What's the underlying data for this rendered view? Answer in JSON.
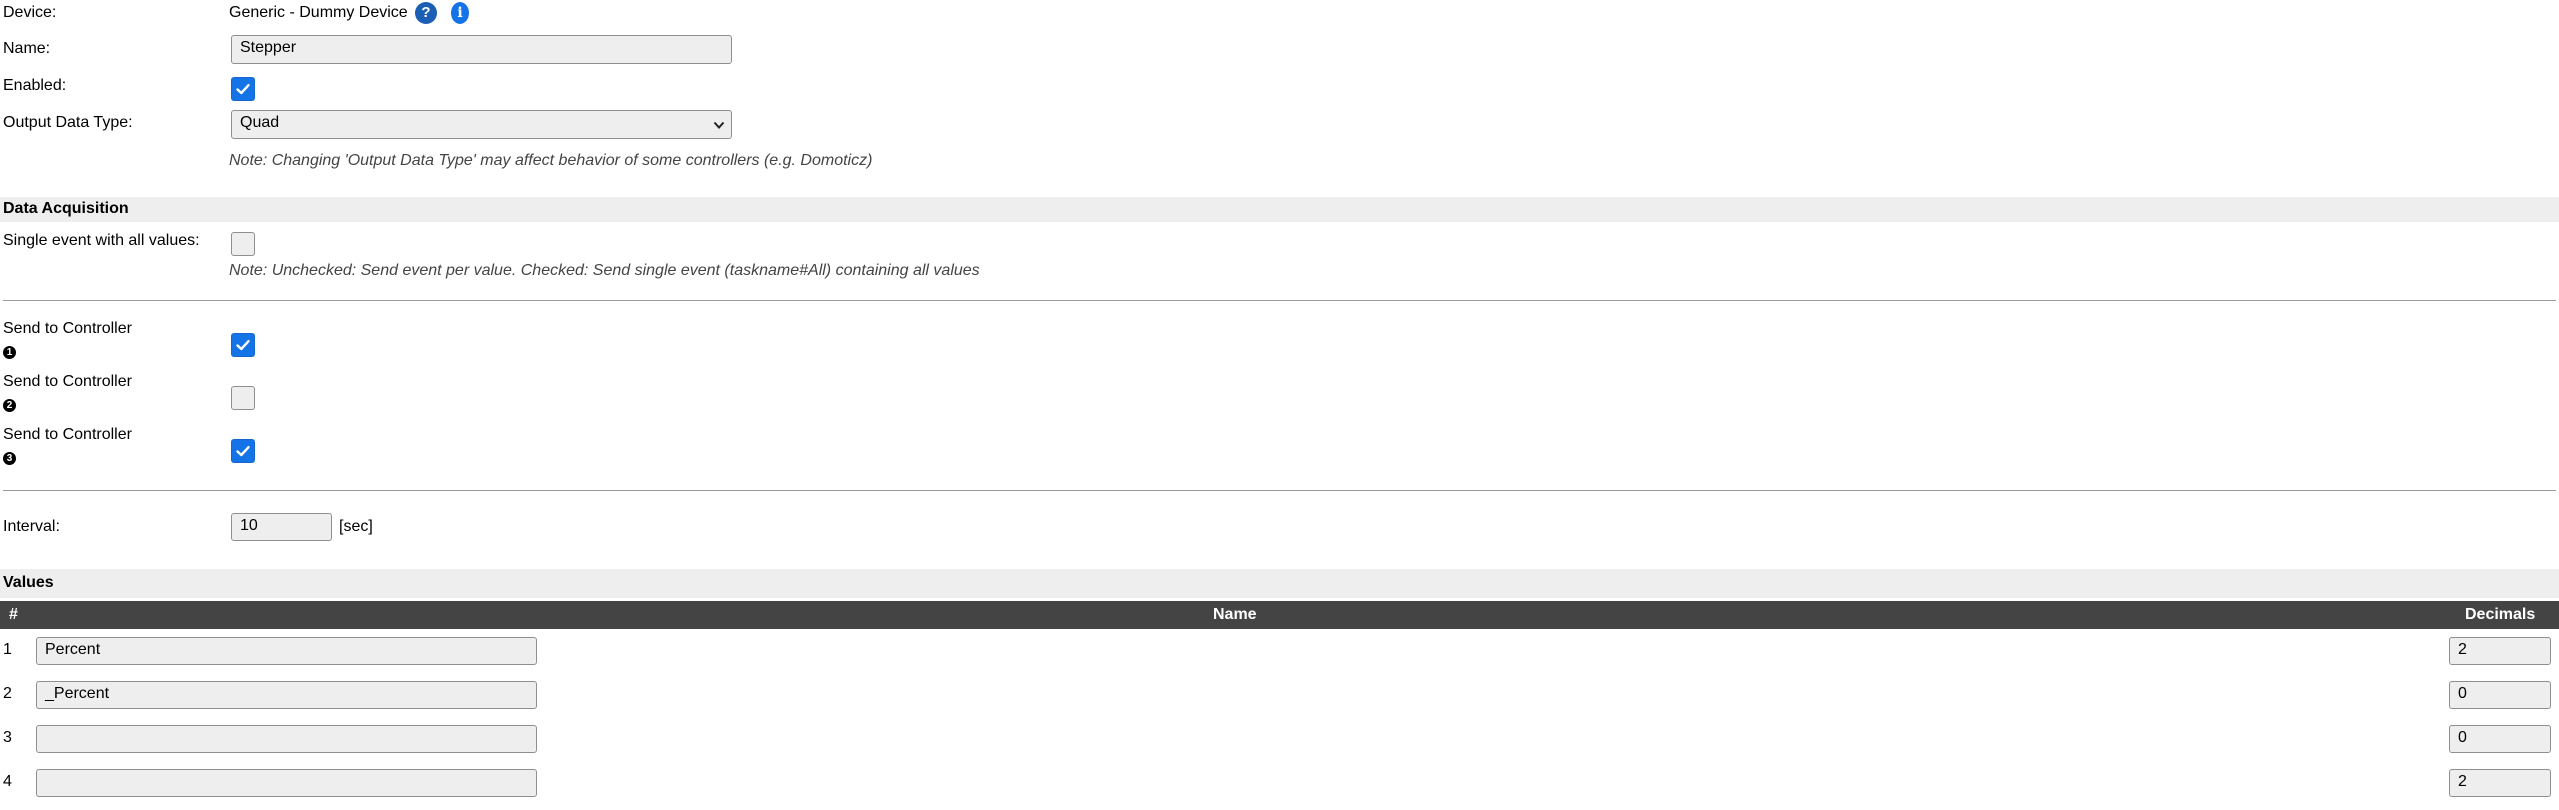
{
  "device": {
    "label": "Device:",
    "value": "Generic - Dummy Device",
    "help_icon": "question-circle-icon",
    "info_icon": "info-circle-icon",
    "help_glyph": "?",
    "info_glyph": "i"
  },
  "name": {
    "label": "Name:",
    "value": "Stepper"
  },
  "enabled": {
    "label": "Enabled:",
    "checked": true
  },
  "output_data_type": {
    "label": "Output Data Type:",
    "selected": "Quad",
    "note": "Note: Changing 'Output Data Type' may affect behavior of some controllers (e.g. Domoticz)"
  },
  "data_acquisition": {
    "title": "Data Acquisition",
    "single_event": {
      "label": "Single event with all values:",
      "checked": false,
      "note": "Note: Unchecked: Send event per value. Checked: Send single event (taskname#All) containing all values"
    },
    "controllers": [
      {
        "label": "Send to Controller",
        "badge": "1",
        "checked": true
      },
      {
        "label": "Send to Controller",
        "badge": "2",
        "checked": false
      },
      {
        "label": "Send to Controller",
        "badge": "3",
        "checked": true
      }
    ],
    "interval": {
      "label": "Interval:",
      "value": "10",
      "unit": "[sec]"
    }
  },
  "values": {
    "title": "Values",
    "headers": {
      "num": "#",
      "name": "Name",
      "decimals": "Decimals"
    },
    "rows": [
      {
        "num": "1",
        "name": "Percent",
        "decimals": "2"
      },
      {
        "num": "2",
        "name": "_Percent",
        "decimals": "0"
      },
      {
        "num": "3",
        "name": "",
        "decimals": "0"
      },
      {
        "num": "4",
        "name": "",
        "decimals": "2"
      }
    ]
  },
  "colors": {
    "accent": "#1473e6",
    "section_bg": "#eeeeee",
    "table_header_bg": "#444444",
    "note_text": "#444444"
  }
}
